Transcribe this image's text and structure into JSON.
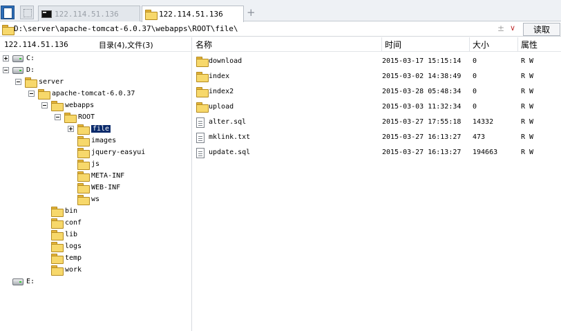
{
  "tabs": [
    {
      "label": "122.114.51.136",
      "icon": "terminal-icon",
      "active": false
    },
    {
      "label": "122.114.51.136",
      "icon": "folder-icon",
      "active": true
    }
  ],
  "new_tab_symbol": "+",
  "path": {
    "value": "D:\\server\\apache-tomcat-6.0.37\\webapps\\ROOT\\file\\",
    "star_symbol": "±",
    "dropdown_symbol": "∨",
    "read_button": "读取"
  },
  "left": {
    "host": "122.114.51.136",
    "summary": "目录(4),文件(3)"
  },
  "tree": [
    {
      "label": "C:",
      "type": "drive",
      "expander": "plus"
    },
    {
      "label": "D:",
      "type": "drive",
      "expander": "minus"
    },
    {
      "label": "server",
      "type": "folder",
      "expander": "minus"
    },
    {
      "label": "apache-tomcat-6.0.37",
      "type": "folder",
      "expander": "minus"
    },
    {
      "label": "webapps",
      "type": "folder",
      "expander": "minus"
    },
    {
      "label": "ROOT",
      "type": "folder",
      "expander": "minus"
    },
    {
      "label": "file",
      "type": "folder",
      "expander": "plus",
      "selected": true
    },
    {
      "label": "images",
      "type": "folder"
    },
    {
      "label": "jquery-easyui",
      "type": "folder"
    },
    {
      "label": "js",
      "type": "folder"
    },
    {
      "label": "META-INF",
      "type": "folder"
    },
    {
      "label": "WEB-INF",
      "type": "folder"
    },
    {
      "label": "ws",
      "type": "folder"
    },
    {
      "label": "bin",
      "type": "folder"
    },
    {
      "label": "conf",
      "type": "folder"
    },
    {
      "label": "lib",
      "type": "folder"
    },
    {
      "label": "logs",
      "type": "folder"
    },
    {
      "label": "temp",
      "type": "folder"
    },
    {
      "label": "work",
      "type": "folder"
    },
    {
      "label": "E:",
      "type": "drive"
    }
  ],
  "columns": {
    "name": "名称",
    "time": "时间",
    "size": "大小",
    "attr": "属性"
  },
  "files": [
    {
      "name": "download",
      "time": "2015-03-17 15:15:14",
      "size": "0",
      "attr": "R W",
      "type": "folder"
    },
    {
      "name": "index",
      "time": "2015-03-02 14:38:49",
      "size": "0",
      "attr": "R W",
      "type": "folder"
    },
    {
      "name": "index2",
      "time": "2015-03-28 05:48:34",
      "size": "0",
      "attr": "R W",
      "type": "folder"
    },
    {
      "name": "upload",
      "time": "2015-03-03 11:32:34",
      "size": "0",
      "attr": "R W",
      "type": "folder"
    },
    {
      "name": "alter.sql",
      "time": "2015-03-27 17:55:18",
      "size": "14332",
      "attr": "R W",
      "type": "file"
    },
    {
      "name": "mklink.txt",
      "time": "2015-03-27 16:13:27",
      "size": "473",
      "attr": "R W",
      "type": "file"
    },
    {
      "name": "update.sql",
      "time": "2015-03-27 16:13:27",
      "size": "194663",
      "attr": "R W",
      "type": "file"
    }
  ]
}
